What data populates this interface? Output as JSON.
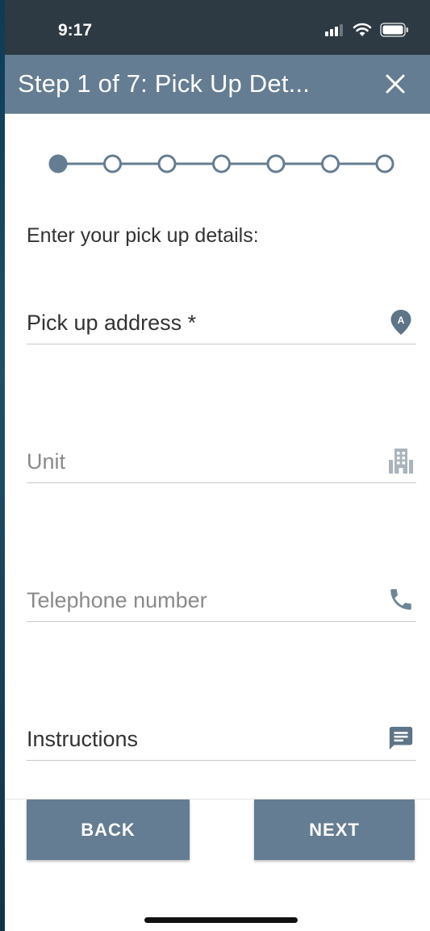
{
  "status_bar": {
    "time": "9:17",
    "icons": [
      "cellular-signal-icon",
      "wifi-icon",
      "battery-icon"
    ]
  },
  "header": {
    "title": "Step 1 of 7: Pick Up Det...",
    "close_icon": "close-icon",
    "background_color": "#647d92"
  },
  "stepper": {
    "total_steps": 7,
    "current_step": 1,
    "color": "#647d92"
  },
  "form": {
    "intro": "Enter your pick up details:",
    "fields": [
      {
        "label": "Pick up address *",
        "icon": "map-marker-a-icon",
        "filled": true
      },
      {
        "label": "Unit",
        "icon": "building-icon",
        "filled": false
      },
      {
        "label": "Telephone number",
        "icon": "phone-icon",
        "filled": false
      },
      {
        "label": "Instructions",
        "icon": "comment-icon",
        "filled": true
      }
    ]
  },
  "footer": {
    "back_label": "BACK",
    "next_label": "NEXT"
  }
}
